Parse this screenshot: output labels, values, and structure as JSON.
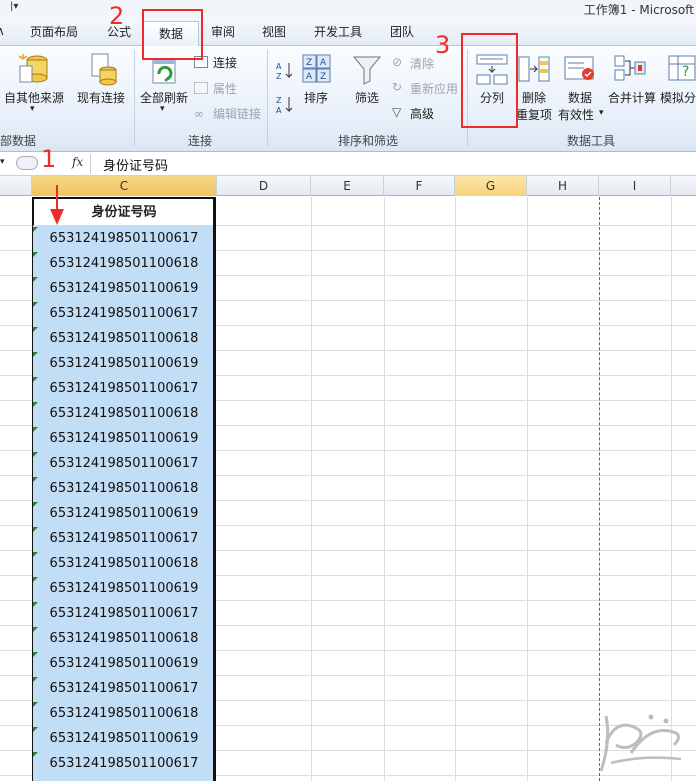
{
  "window": {
    "title": "工作簿1 - Microsoft"
  },
  "tabs": [
    {
      "label": "页面布局"
    },
    {
      "label": "公式"
    },
    {
      "label": "数据",
      "active": true
    },
    {
      "label": "审阅"
    },
    {
      "label": "视图"
    },
    {
      "label": "开发工具"
    },
    {
      "label": "团队"
    }
  ],
  "ribbon": {
    "get_external": {
      "from_other": "自其他来源",
      "existing": "现有连接",
      "group_label": "部数据"
    },
    "connections": {
      "refresh_all": "全部刷新",
      "connections": "连接",
      "properties": "属性",
      "edit_links": "编辑链接",
      "group_label": "连接"
    },
    "sort_filter": {
      "sort": "排序",
      "filter": "筛选",
      "clear": "清除",
      "reapply": "重新应用",
      "advanced": "高级",
      "group_label": "排序和筛选"
    },
    "data_tools": {
      "text_to_columns": "分列",
      "remove_dup_1": "删除",
      "remove_dup_2": "重复项",
      "validation_1": "数据",
      "validation_2": "有效性",
      "consolidate": "合并计算",
      "whatif": "模拟分",
      "group_label": "数据工具"
    }
  },
  "formula_bar": {
    "fx": "fx",
    "value": "身份证号码"
  },
  "columns": [
    "C",
    "D",
    "E",
    "F",
    "G",
    "H",
    "I"
  ],
  "sheet": {
    "header": "身份证号码",
    "rows": [
      "653124198501100617",
      "653124198501100618",
      "653124198501100619",
      "653124198501100617",
      "653124198501100618",
      "653124198501100619",
      "653124198501100617",
      "653124198501100618",
      "653124198501100619",
      "653124198501100617",
      "653124198501100618",
      "653124198501100619",
      "653124198501100617",
      "653124198501100618",
      "653124198501100619",
      "653124198501100617",
      "653124198501100618",
      "653124198501100619",
      "653124198501100617",
      "653124198501100618",
      "653124198501100619",
      "653124198501100617"
    ]
  },
  "annotations": {
    "step1": "1",
    "step2": "2",
    "step3": "3"
  },
  "colors": {
    "annotation": "#ee2b2b",
    "selection": "#c2ddf6",
    "active_col": "#f8d27a"
  }
}
